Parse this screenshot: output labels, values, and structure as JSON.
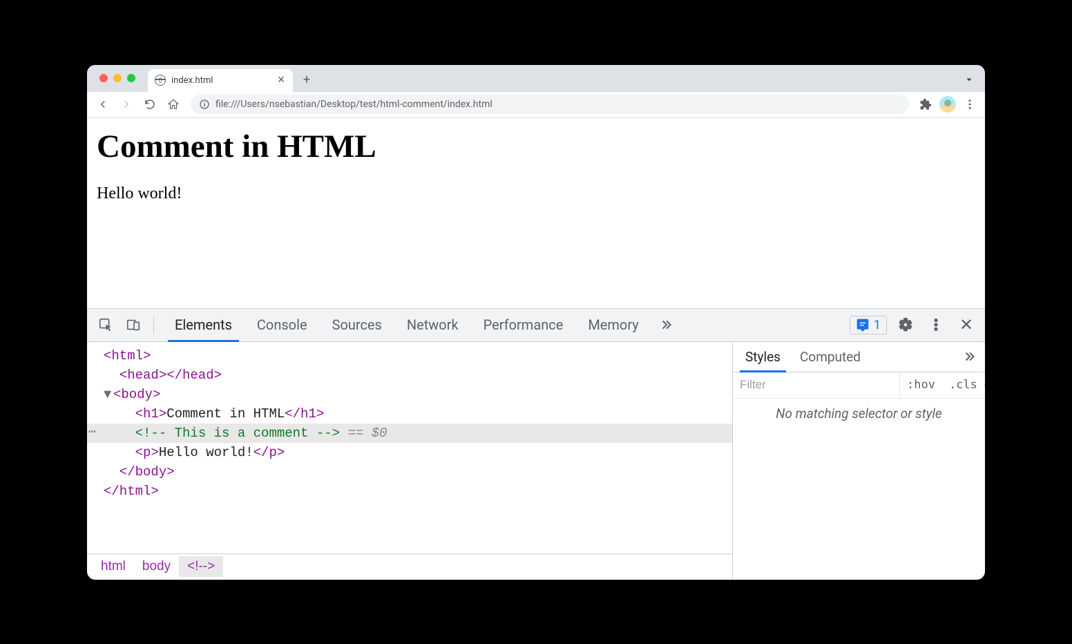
{
  "browser": {
    "tab": {
      "title": "index.html"
    },
    "url": "file:///Users/nsebastian/Desktop/test/html-comment/index.html"
  },
  "page": {
    "heading": "Comment in HTML",
    "paragraph": "Hello world!"
  },
  "devtools": {
    "tabs": [
      "Elements",
      "Console",
      "Sources",
      "Network",
      "Performance",
      "Memory"
    ],
    "issues_count": "1",
    "dom": {
      "l0": "<html>",
      "l1": "<head></head>",
      "l2": "<body>",
      "l3_open": "<h1>",
      "l3_text": "Comment in HTML",
      "l3_close": "</h1>",
      "l4": "<!-- This is a comment -->",
      "l4_eq": " == ",
      "l4_dollar": "$0",
      "l5_open": "<p>",
      "l5_text": "Hello world!",
      "l5_close": "</p>",
      "l6": "</body>",
      "l7": "</html>"
    },
    "breadcrumb": [
      "html",
      "body",
      "<!-->"
    ],
    "styles": {
      "tabs": [
        "Styles",
        "Computed"
      ],
      "filter_placeholder": "Filter",
      "hov": ":hov",
      "cls": ".cls",
      "message": "No matching selector or style"
    }
  }
}
